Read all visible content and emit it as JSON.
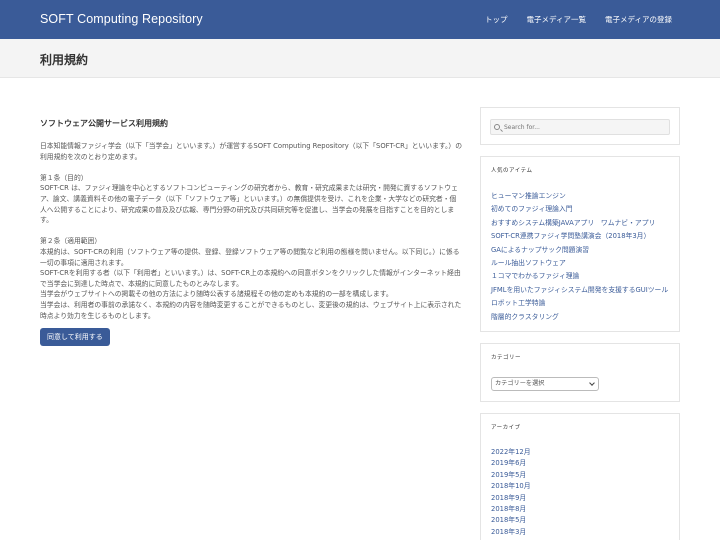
{
  "header": {
    "brand": "SOFT Computing Repository",
    "nav": [
      "トップ",
      "電子メディア一覧",
      "電子メディアの登録"
    ]
  },
  "page": {
    "title": "利用規約"
  },
  "main": {
    "section_title": "ソフトウェア公開サービス利用規約",
    "intro": "日本知能情報ファジィ学会（以下「当学会」といいます。）が運営するSOFT Computing Repository（以下「SOFT-CR」といいます。）の利用規約を次のとおり定めます。",
    "article1_title": "第１条（目的）",
    "article1_text": "SOFT-CR は、ファジィ理論を中心とするソフトコンピューティングの研究者から、教育・研究成果または研究・開発に資するソフトウェア、論文、講義資料その他の電子データ（以下「ソフトウェア等」といいます。）の無償提供を受け、これを企業・大学などの研究者・個人へ公開することにより、研究成果の普及及び広報、専門分野の研究及び共同研究等を促進し、当学会の発展を目指すことを目的とします。",
    "article2_title": "第２条（適用範囲）",
    "article2_p1": "本規約は、SOFT-CRの利用（ソフトウェア等の提供、登録、登録ソフトウェア等の閲覧など利用の態様を問いません。以下同じ。）に係る一切の事項に適用されます。",
    "article2_p2": "SOFT-CRを利用する者（以下「利用者」といいます。）は、SOFT-CR上の本規約への同意ボタンをクリックした情報がインターネット経由で当学会に到達した時点で、本規約に同意したものとみなします。",
    "article2_p3": "当学会がウェブサイトへの掲載その他の方法により随時公表する諸規程その他の定めも本規約の一部を構成します。",
    "article2_p4": "当学会は、利用者の事前の承諾なく、本規約の内容を随時変更することができるものとし、変更後の規約は、ウェブサイト上に表示された時点より効力を生じるものとします。",
    "agree_label": "同意して利用する"
  },
  "sidebar": {
    "search_placeholder": "Search for...",
    "popular_title": "人気のアイテム",
    "popular_items": [
      "ヒューマン推論エンジン",
      "初めてのファジィ理論入門",
      "おすすめシステム構築JAVAアプリ　ワムナビ・アプリ",
      "SOFT-CR連携ファジィ学問塾講演会（2018年3月）",
      "GAによるナップサック問題演習",
      "ルール抽出ソフトウェア",
      "１コマでわかるファジィ理論",
      "JFMLを用いたファジィシステム開発を支援するGUIツール",
      "ロボット工学特論",
      "階層的クラスタリング"
    ],
    "category_title": "カテゴリー",
    "category_select": "カテゴリーを選択",
    "archive_title": "アーカイブ",
    "archive_items": [
      "2022年12月",
      "2019年6月",
      "2019年5月",
      "2018年10月",
      "2018年9月",
      "2018年8月",
      "2018年5月",
      "2018年3月"
    ]
  },
  "colors": {
    "header_bg": "#3a5b98",
    "link": "#3a5b98",
    "titlebar_bg": "#f4f4f4"
  }
}
